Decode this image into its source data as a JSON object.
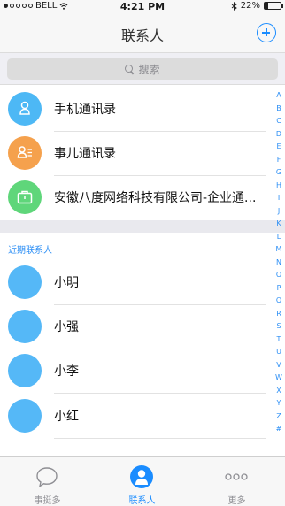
{
  "status_bar": {
    "carrier": "BELL",
    "time": "4:21 PM",
    "battery_percent": "22%",
    "battery_level": 0.22,
    "signal_dots_full": 1,
    "signal_dots_total": 5
  },
  "nav": {
    "title": "联系人"
  },
  "search": {
    "placeholder": "搜索"
  },
  "top_items": [
    {
      "label": "手机通讯录",
      "icon": "phone-book-icon",
      "color": "#4db8f5"
    },
    {
      "label": "事儿通讯录",
      "icon": "contact-list-icon",
      "color": "#f5a14d"
    },
    {
      "label": "安徽八度网络科技有限公司-企业通...",
      "icon": "briefcase-icon",
      "color": "#5fd67a"
    }
  ],
  "recent": {
    "header": "近期联系人",
    "contacts": [
      {
        "name": "小明",
        "color": "#55b8f7"
      },
      {
        "name": "小强",
        "color": "#55b8f7"
      },
      {
        "name": "小李",
        "color": "#55b8f7"
      },
      {
        "name": "小红",
        "color": "#55b8f7"
      }
    ]
  },
  "index_letters": [
    "A",
    "B",
    "C",
    "D",
    "E",
    "F",
    "G",
    "H",
    "I",
    "J",
    "K",
    "L",
    "M",
    "N",
    "O",
    "P",
    "Q",
    "R",
    "S",
    "T",
    "U",
    "V",
    "W",
    "X",
    "Y",
    "Z",
    "#"
  ],
  "tabs": [
    {
      "label": "事挺多",
      "icon": "chat-bubble-icon",
      "active": false
    },
    {
      "label": "联系人",
      "icon": "person-icon",
      "active": true
    },
    {
      "label": "更多",
      "icon": "more-dots-icon",
      "active": false
    }
  ],
  "colors": {
    "accent": "#1a8cff",
    "index_text": "#2b8ef5"
  }
}
